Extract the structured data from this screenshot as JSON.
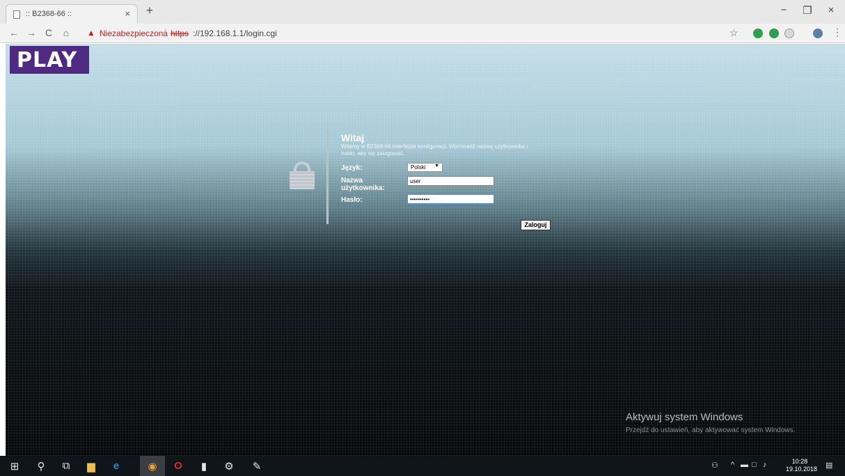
{
  "browser": {
    "tab_title": ":: B2368-66 ::",
    "tab_close": "×",
    "new_tab": "+",
    "window_controls": {
      "minimize": "−",
      "maximize": "❐",
      "close": "×"
    },
    "nav": {
      "back": "←",
      "forward": "→",
      "reload": "C",
      "home": "⌂"
    },
    "security_warning": "Niezabezpieczona",
    "url_scheme": "https",
    "url_rest": "://192.168.1.1/login.cgi",
    "bookmark_star": "☆",
    "menu": "⋮"
  },
  "page": {
    "logo_text": "PLAY",
    "welcome_title": "Witaj",
    "welcome_text": "Witamy w B2368-66 interfejsie konfiguracji. Wprowadź nazwę użytkownika i hasło, aby się zalogować.",
    "language_label": "Język:",
    "language_value": "Polski",
    "username_label": "Nazwa użytkownika:",
    "username_value": "user",
    "password_label": "Hasło:",
    "password_value": "••••••••••",
    "login_button": "Zaloguj"
  },
  "watermark": {
    "title": "Aktywuj system Windows",
    "subtitle": "Przejdź do ustawień, aby aktywować system Windows."
  },
  "taskbar": {
    "time": "10:28",
    "date": "19.10.2018"
  },
  "colors": {
    "brand_purple": "#4e2a82",
    "security_red": "#c5221f"
  }
}
